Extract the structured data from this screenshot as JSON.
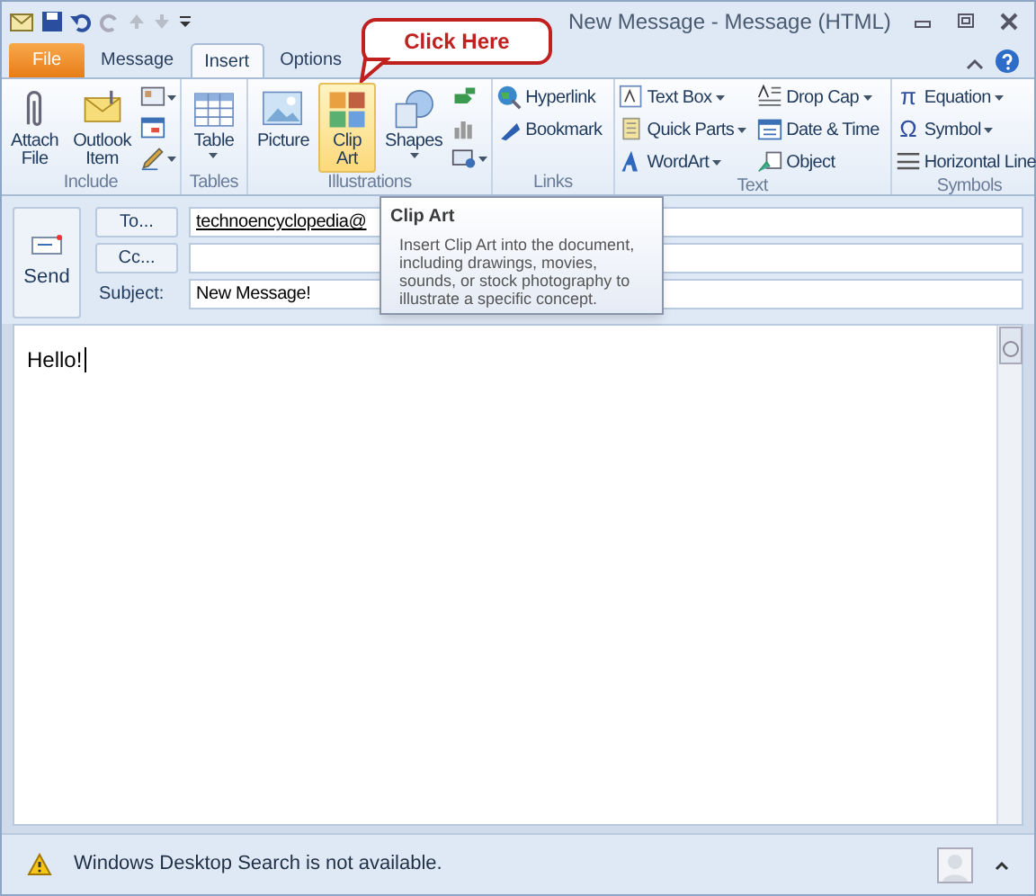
{
  "window": {
    "title": "New Message - Message (HTML)"
  },
  "callout": {
    "text": "Click Here"
  },
  "tabs": [
    {
      "label": "File",
      "kind": "backstage",
      "selected": false
    },
    {
      "label": "Message",
      "kind": "tab",
      "selected": false
    },
    {
      "label": "Insert",
      "kind": "tab",
      "selected": true
    },
    {
      "label": "Options",
      "kind": "tab",
      "selected": false
    }
  ],
  "ribbon": {
    "groups": [
      {
        "label": "Include",
        "columns": [
          [
            {
              "kind": "large",
              "label": "Attach File",
              "hovered": false,
              "dropdown": false
            }
          ],
          [
            {
              "kind": "large",
              "label": "Outlook Item",
              "hovered": false,
              "dropdown": false
            }
          ],
          [
            {
              "kind": "icon",
              "dropdown": true
            },
            {
              "kind": "icon",
              "dropdown": false
            },
            {
              "kind": "icon",
              "dropdown": true
            }
          ]
        ]
      },
      {
        "label": "Tables",
        "columns": [
          [
            {
              "kind": "large",
              "label": "Table",
              "hovered": false,
              "dropdown": true
            }
          ]
        ]
      },
      {
        "label": "Illustrations",
        "columns": [
          [
            {
              "kind": "large",
              "label": "Picture",
              "hovered": false,
              "dropdown": false
            }
          ],
          [
            {
              "kind": "large",
              "label": "Clip Art",
              "hovered": true,
              "dropdown": false
            }
          ],
          [
            {
              "kind": "large",
              "label": "Shapes",
              "hovered": false,
              "dropdown": true
            }
          ],
          [
            {
              "kind": "icon",
              "dropdown": false
            },
            {
              "kind": "icon",
              "dropdown": false
            },
            {
              "kind": "icon",
              "dropdown": true
            }
          ]
        ]
      },
      {
        "label": "Links",
        "columns": [
          [
            {
              "kind": "small",
              "label": "Hyperlink",
              "dropdown": false
            },
            {
              "kind": "small",
              "label": "Bookmark",
              "dropdown": false
            }
          ]
        ]
      },
      {
        "label": "Text",
        "columns": [
          [
            {
              "kind": "small",
              "label": "Text Box",
              "dropdown": true
            },
            {
              "kind": "small",
              "label": "Quick Parts",
              "dropdown": true
            },
            {
              "kind": "small",
              "label": "WordArt",
              "dropdown": true
            }
          ],
          [
            {
              "kind": "small",
              "label": "Drop Cap",
              "dropdown": true
            },
            {
              "kind": "small",
              "label": "Date & Time",
              "dropdown": false
            },
            {
              "kind": "small",
              "label": "Object",
              "dropdown": false
            }
          ]
        ]
      },
      {
        "label": "Symbols",
        "columns": [
          [
            {
              "kind": "small",
              "glyph": "π",
              "label": "Equation",
              "dropdown": true
            },
            {
              "kind": "small",
              "glyph": "Ω",
              "label": "Symbol",
              "dropdown": true
            },
            {
              "kind": "small",
              "label": "Horizontal Line",
              "dropdown": false
            }
          ]
        ]
      }
    ]
  },
  "tooltip": {
    "title": "Clip Art",
    "text": "Insert Clip Art into the document, including drawings, movies, sounds, or stock photography to illustrate a specific concept."
  },
  "header": {
    "send_label": "Send",
    "fields": [
      {
        "kind": "button",
        "label": "To...",
        "value": "technoencyclopedia@"
      },
      {
        "kind": "button",
        "label": "Cc..."
      },
      {
        "kind": "label",
        "label": "Subject:",
        "value": "New Message!"
      }
    ]
  },
  "body": {
    "text": "Hello!"
  },
  "status_bar": {
    "message": "Windows Desktop Search is not available."
  }
}
